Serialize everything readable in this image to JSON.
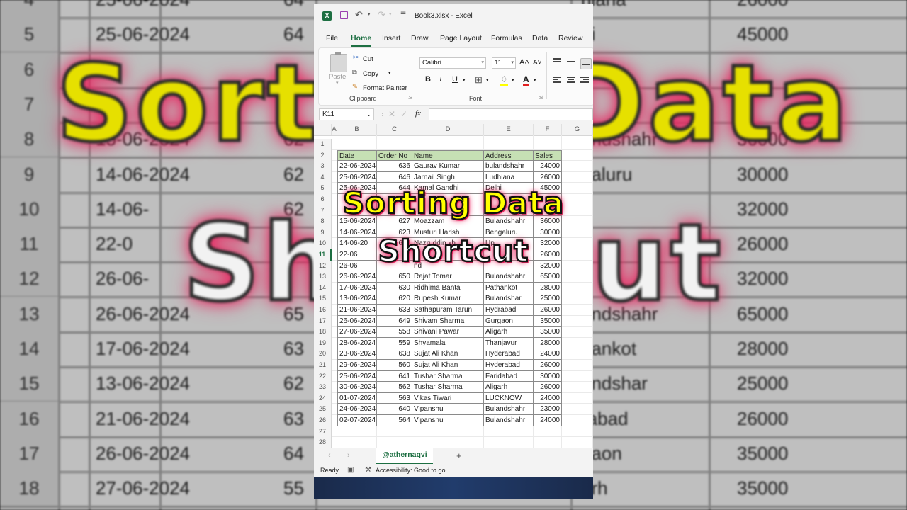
{
  "background": {
    "rows": [
      {
        "num": "4",
        "date": "25-06-2024",
        "order": "64",
        "city": "hiana",
        "sales": "26000"
      },
      {
        "num": "5",
        "date": "25-06-2024",
        "order": "64",
        "city": "hi",
        "sales": "45000"
      },
      {
        "num": "6",
        "date": "",
        "order": "",
        "city": "",
        "sales": ""
      },
      {
        "num": "7",
        "date": "",
        "order": "6",
        "city": "",
        "sales": ""
      },
      {
        "num": "8",
        "date": "15-06-2024",
        "order": "62",
        "city": "andshahr",
        "sales": "36000"
      },
      {
        "num": "9",
        "date": "14-06-2024",
        "order": "62",
        "city": "galuru",
        "sales": "30000"
      },
      {
        "num": "10",
        "date": "14-06-",
        "order": "62",
        "city": "",
        "sales": "32000"
      },
      {
        "num": "11",
        "date": "22-0",
        "order": "",
        "city": "",
        "sales": "26000"
      },
      {
        "num": "12",
        "date": "26-06-",
        "order": "",
        "city": "",
        "sales": "32000"
      },
      {
        "num": "13",
        "date": "26-06-2024",
        "order": "65",
        "city": "andshahr",
        "sales": "65000"
      },
      {
        "num": "14",
        "date": "17-06-2024",
        "order": "63",
        "city": "hankot",
        "sales": "28000"
      },
      {
        "num": "15",
        "date": "13-06-2024",
        "order": "62",
        "city": "andshar",
        "sales": "25000"
      },
      {
        "num": "16",
        "date": "21-06-2024",
        "order": "63",
        "city": "rabad",
        "sales": "26000"
      },
      {
        "num": "17",
        "date": "26-06-2024",
        "order": "64",
        "city": "gaon",
        "sales": "35000"
      },
      {
        "num": "18",
        "date": "27-06-2024",
        "order": "55",
        "city": "arh",
        "sales": "35000"
      }
    ],
    "title_line1": "Sorting Data",
    "title_line2": "Shortcut"
  },
  "window": {
    "app_icon": "X",
    "title": "Book3.xlsx  -  Excel",
    "menu": [
      "File",
      "Home",
      "Insert",
      "Draw",
      "Page Layout",
      "Formulas",
      "Data",
      "Review"
    ],
    "active_menu": "Home"
  },
  "ribbon": {
    "paste": "Paste",
    "cut": "Cut",
    "copy": "Copy",
    "format_painter": "Format Painter",
    "clipboard_label": "Clipboard",
    "font_name": "Calibri",
    "font_size": "11",
    "grow": "A˄",
    "shrink": "A˅",
    "bold": "B",
    "italic": "I",
    "underline": "U",
    "font_color": "A",
    "font_label": "Font"
  },
  "formula_bar": {
    "name_box": "K11",
    "fx": "fx",
    "value": ""
  },
  "grid": {
    "columns": [
      "A",
      "B",
      "C",
      "D",
      "E",
      "F",
      "G"
    ],
    "row_numbers": [
      "1",
      "2",
      "3",
      "4",
      "5",
      "6",
      "7",
      "8",
      "9",
      "10",
      "11",
      "12",
      "13",
      "14",
      "15",
      "16",
      "17",
      "18",
      "19",
      "20",
      "21",
      "22",
      "23",
      "24",
      "25",
      "26",
      "27",
      "28"
    ],
    "headers": [
      "Date",
      "Order No",
      "Name",
      "Address",
      "Sales"
    ],
    "rows": [
      [
        "22-06-2024",
        "636",
        "Gaurav Kumar",
        "bulandshahr",
        "24000"
      ],
      [
        "25-06-2024",
        "646",
        "Jarnail Singh",
        "Ludhiana",
        "26000"
      ],
      [
        "25-06-2024",
        "644",
        "Kamal Gandhi",
        "Delhi",
        "45000"
      ],
      [
        "",
        "",
        "",
        "",
        ""
      ],
      [
        "",
        "",
        "",
        "",
        ""
      ],
      [
        "15-06-2024",
        "627",
        "Moazzam",
        "Bulandshahr",
        "36000"
      ],
      [
        "14-06-2024",
        "623",
        "Musturi Harish",
        "Bengaluru",
        "30000"
      ],
      [
        "14-06-20",
        "624",
        "Nazruddin kh",
        "Up",
        "32000"
      ],
      [
        "22-06",
        "",
        "",
        "",
        "26000"
      ],
      [
        "26-06",
        "",
        "nd",
        "",
        "32000"
      ],
      [
        "26-06-2024",
        "650",
        "Rajat Tomar",
        "Bulandshahr",
        "65000"
      ],
      [
        "17-06-2024",
        "630",
        "Ridhima Banta",
        "Pathankot",
        "28000"
      ],
      [
        "13-06-2024",
        "620",
        "Rupesh Kumar",
        "Bulandshar",
        "25000"
      ],
      [
        "21-06-2024",
        "633",
        "Sathapuram Tarun",
        "Hydrabad",
        "26000"
      ],
      [
        "26-06-2024",
        "649",
        "Shivam Sharma",
        "Gurgaon",
        "35000"
      ],
      [
        "27-06-2024",
        "558",
        "Shivani Pawar",
        "Aligarh",
        "35000"
      ],
      [
        "28-06-2024",
        "559",
        "Shyamala",
        "Thanjavur",
        "28000"
      ],
      [
        "23-06-2024",
        "638",
        "Sujat Ali Khan",
        "Hyderabad",
        "24000"
      ],
      [
        "29-06-2024",
        "560",
        "Sujat Ali Khan",
        "Hyderabad",
        "26000"
      ],
      [
        "25-06-2024",
        "641",
        "Tushar Sharma",
        "Faridabad",
        "30000"
      ],
      [
        "30-06-2024",
        "562",
        "Tushar Sharma",
        "Aligarh",
        "26000"
      ],
      [
        "01-07-2024",
        "563",
        "Vikas Tiwari",
        "LUCKNOW",
        "24000"
      ],
      [
        "24-06-2024",
        "640",
        "Vipanshu",
        "Bulandshahr",
        "23000"
      ],
      [
        "02-07-2024",
        "564",
        "Vipanshu",
        "Bulandshahr",
        "24000"
      ]
    ]
  },
  "sheet_tabs": {
    "active": "@athernaqvi",
    "add": "+"
  },
  "status_bar": {
    "ready": "Ready",
    "accessibility": "Accessibility: Good to go"
  },
  "overlay": {
    "line1": "Sorting Data",
    "line2": "Shortcut"
  },
  "colors": {
    "excel_green": "#1d6f42",
    "header_fill": "#c6e0b4",
    "caption_yellow": "#ffff00",
    "caption_glow": "#e8245f"
  }
}
